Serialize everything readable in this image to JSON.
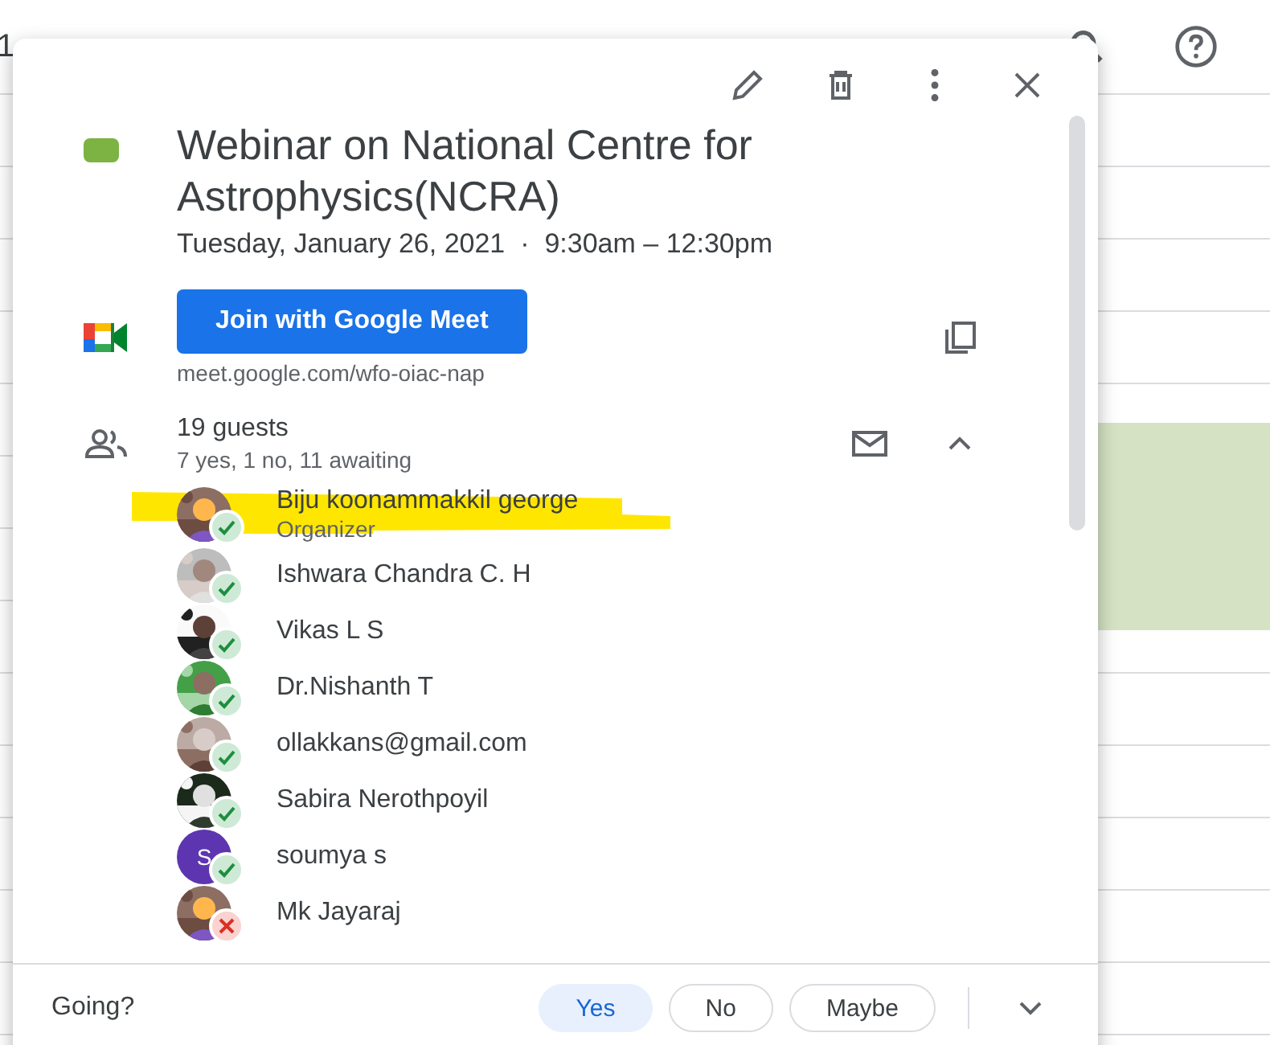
{
  "background": {
    "date_fragment": "1"
  },
  "event": {
    "color": "#7cb342",
    "title": "Webinar on National Centre for Astrophysics(NCRA)",
    "date": "Tuesday, January 26, 2021",
    "separator": "·",
    "time": "9:30am – 12:30pm",
    "join_button": "Join with Google Meet",
    "meet_link": "meet.google.com/wfo-oiac-nap"
  },
  "guests": {
    "count": "19 guests",
    "summary": "7 yes, 1 no, 11 awaiting",
    "expanded": true,
    "list": [
      {
        "name": "Biju koonammakkil george",
        "role": "Organizer",
        "accepted": true,
        "highlighted": true
      },
      {
        "name": "Ishwara Chandra C. H",
        "accepted": true,
        "highlighted": false
      },
      {
        "name": "Vikas L S",
        "accepted": true,
        "highlighted": false
      },
      {
        "name": "Dr.Nishanth T",
        "accepted": true,
        "highlighted": false
      },
      {
        "name": "ollakkans@gmail.com",
        "accepted": true,
        "highlighted": false
      },
      {
        "name": "Sabira Nerothpoyil",
        "accepted": true,
        "highlighted": false
      },
      {
        "name": "soumya s",
        "kind": "letter",
        "letter": "S",
        "color": "#5e35b1",
        "accepted": true,
        "highlighted": false
      },
      {
        "name": "Mk Jayaraj",
        "accepted": false,
        "highlighted": false
      }
    ]
  },
  "rsvp": {
    "label": "Going?",
    "options": [
      {
        "label": "Yes",
        "selected": true
      },
      {
        "label": "No",
        "selected": false
      },
      {
        "label": "Maybe",
        "selected": false
      }
    ]
  }
}
